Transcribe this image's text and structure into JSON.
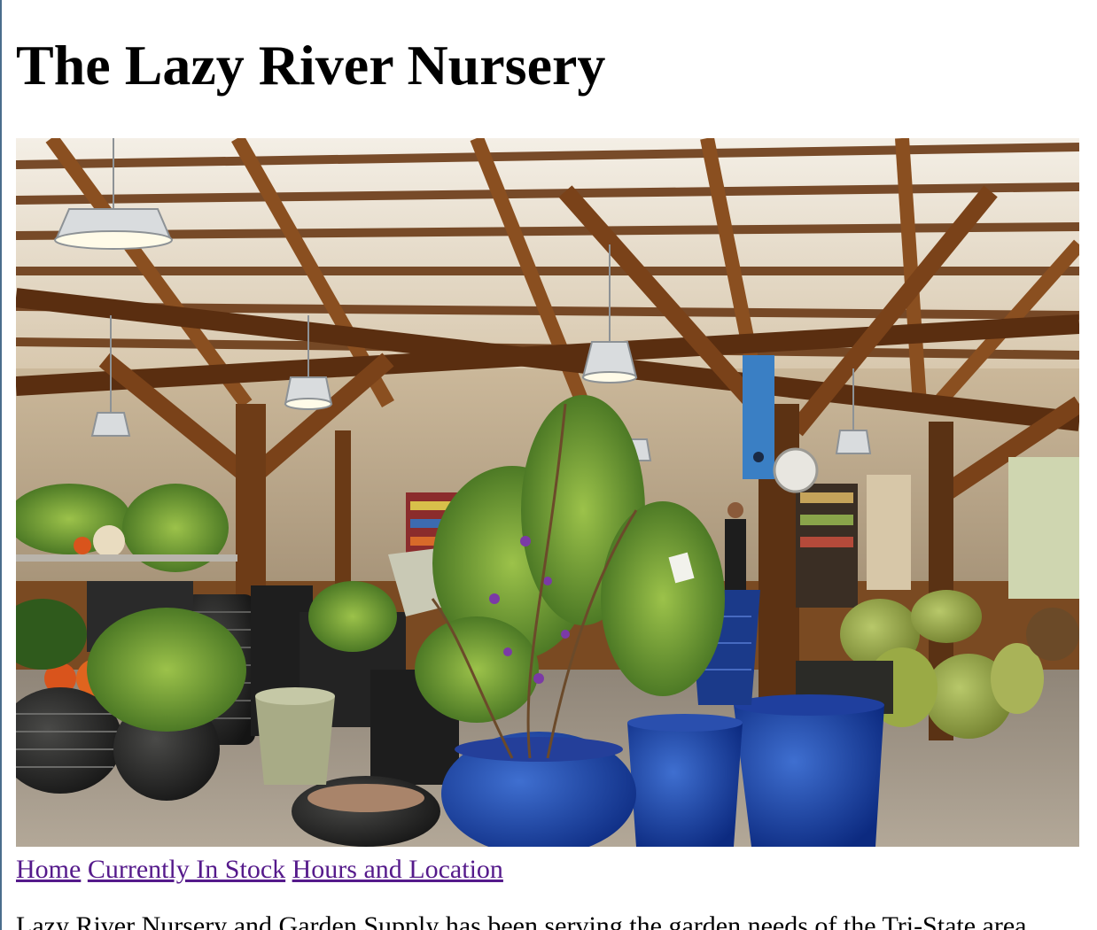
{
  "page": {
    "title": "The Lazy River Nursery"
  },
  "hero": {
    "image_label": "nursery-interior-photo"
  },
  "nav": {
    "links": [
      {
        "label": "Home"
      },
      {
        "label": "Currently In Stock"
      },
      {
        "label": "Hours and Location"
      }
    ]
  },
  "intro": {
    "text": "Lazy River Nursery and Garden Supply has been serving the garden needs of the Tri-State area"
  },
  "colors": {
    "link_visited": "#551a8b",
    "text": "#000000",
    "background": "#ffffff"
  }
}
